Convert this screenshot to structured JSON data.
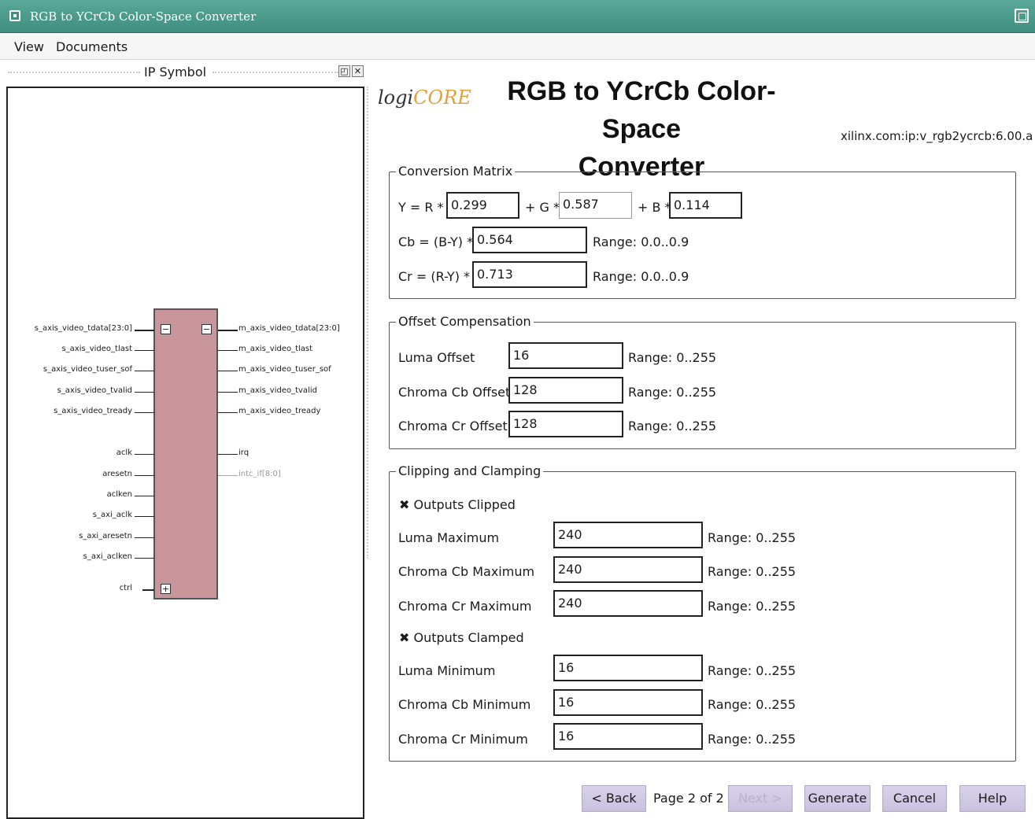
{
  "window": {
    "title": "RGB to YCrCb Color-Space Converter"
  },
  "menu": {
    "items": [
      "View",
      "Documents"
    ]
  },
  "left_panel": {
    "title": "IP Symbol",
    "float_btn": "◰",
    "close_btn": "✕",
    "symbol": {
      "inputs": [
        "s_axis_video_tdata[23:0]",
        "s_axis_video_tlast",
        "s_axis_video_tuser_sof",
        "s_axis_video_tvalid",
        "s_axis_video_tready",
        "aclk",
        "aresetn",
        "aclken",
        "s_axi_aclk",
        "s_axi_aresetn",
        "s_axi_aclken",
        "ctrl"
      ],
      "outputs": [
        "m_axis_video_tdata[23:0]",
        "m_axis_video_tlast",
        "m_axis_video_tuser_sof",
        "m_axis_video_tvalid",
        "m_axis_video_tready",
        "irq",
        "intc_if[8:0]"
      ],
      "minus": "−",
      "plus": "+"
    }
  },
  "header": {
    "logo_left": "logi",
    "logo_right": "CORE",
    "title_line1": "RGB to YCrCb Color-Space",
    "title_line2": "Converter",
    "vlnv": "xilinx.com:ip:v_rgb2ycrcb:6.00.a"
  },
  "conversion_matrix": {
    "legend": "Conversion Matrix",
    "y_label": "Y = R *",
    "g_label": "+ G *",
    "b_label": "+ B *",
    "r_coef": "0.299",
    "g_coef": "0.587",
    "b_coef": "0.114",
    "cb_label": "Cb = (B-Y) *",
    "cb_coef": "0.564",
    "cb_range": "Range: 0.0..0.9",
    "cr_label": "Cr = (R-Y) *",
    "cr_coef": "0.713",
    "cr_range": "Range: 0.0..0.9"
  },
  "offset_compensation": {
    "legend": "Offset Compensation",
    "rows": [
      {
        "label": "Luma Offset",
        "value": "16",
        "range": "Range: 0..255"
      },
      {
        "label": "Chroma Cb Offset",
        "value": "128",
        "range": "Range: 0..255"
      },
      {
        "label": "Chroma Cr Offset",
        "value": "128",
        "range": "Range: 0..255"
      }
    ]
  },
  "clipping": {
    "legend": "Clipping and Clamping",
    "check_mark": "✖",
    "outputs_clipped": "Outputs Clipped",
    "clipped_rows": [
      {
        "label": "Luma Maximum",
        "value": "240",
        "range": "Range: 0..255"
      },
      {
        "label": "Chroma Cb Maximum",
        "value": "240",
        "range": "Range: 0..255"
      },
      {
        "label": "Chroma Cr Maximum",
        "value": "240",
        "range": "Range: 0..255"
      }
    ],
    "outputs_clamped": "Outputs Clamped",
    "clamped_rows": [
      {
        "label": "Luma Minimum",
        "value": "16",
        "range": "Range: 0..255"
      },
      {
        "label": "Chroma Cb Minimum",
        "value": "16",
        "range": "Range: 0..255"
      },
      {
        "label": "Chroma Cr Minimum",
        "value": "16",
        "range": "Range: 0..255"
      }
    ]
  },
  "footer": {
    "back": "< Back",
    "page_info": "Page 2 of 2",
    "next": "Next >",
    "generate": "Generate",
    "cancel": "Cancel",
    "help": "Help"
  }
}
